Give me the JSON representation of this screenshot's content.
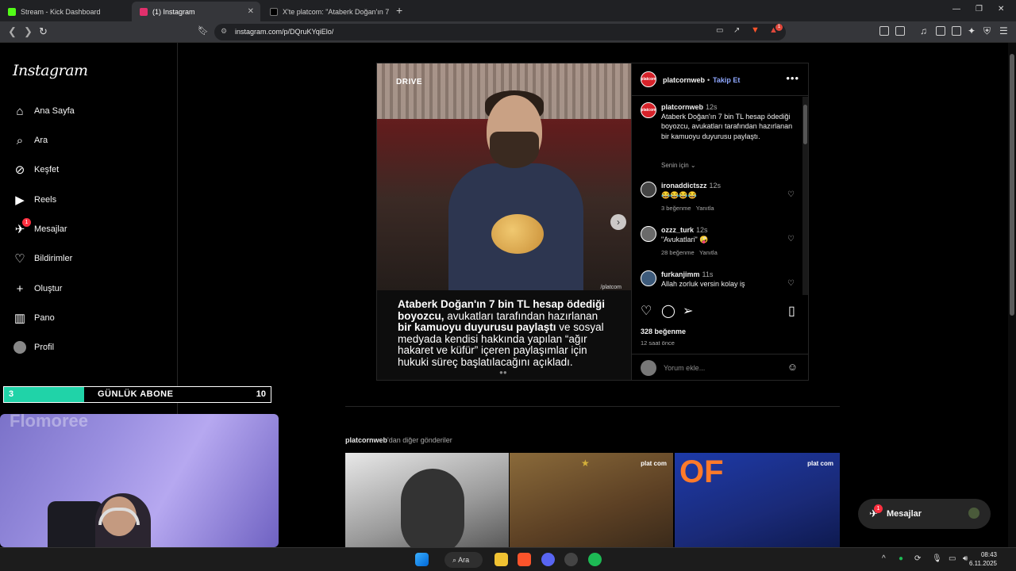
{
  "browser": {
    "tabs": [
      {
        "title": "Stream - Kick Dashboard",
        "color": "#53fc18"
      },
      {
        "title": "(1) Instagram",
        "color": "#e1306c"
      },
      {
        "title": "X'te platcom: \"Ataberk Doğan'ın 7 bin",
        "color": "#000000"
      }
    ],
    "url": "instagram.com/p/DQruKYqiElo/",
    "notif_count": "1"
  },
  "sidebar": {
    "logo": "Instagram",
    "items": [
      {
        "label": "Ana Sayfa",
        "icon": "home-icon"
      },
      {
        "label": "Ara",
        "icon": "search-icon"
      },
      {
        "label": "Keşfet",
        "icon": "compass-icon"
      },
      {
        "label": "Reels",
        "icon": "reels-icon"
      },
      {
        "label": "Mesajlar",
        "icon": "messenger-icon",
        "badge": "1"
      },
      {
        "label": "Bildirimler",
        "icon": "heart-icon"
      },
      {
        "label": "Oluştur",
        "icon": "plus-icon"
      },
      {
        "label": "Pano",
        "icon": "dashboard-icon"
      },
      {
        "label": "Profil",
        "icon": "avatar-icon"
      }
    ]
  },
  "overlay": {
    "sub_goal": {
      "current": "3",
      "label": "GÜNLÜK ABONE",
      "target": "10",
      "progress": 0.3,
      "fill_color": "#20d3a8"
    },
    "webcam_text": "Flomoree"
  },
  "post": {
    "media": {
      "brand": "DRIVE",
      "watermark": "/platcom",
      "caption_bold_1": "Ataberk Doğan'ın 7 bin TL hesap ödediği boyozcu,",
      "caption_plain_1": " avukatları tarafından hazırlanan ",
      "caption_bold_2": "bir kamuoyu duyurusu paylaştı",
      "caption_plain_2": " ve sosyal medyada kendisi hakkında yapılan “ağır hakaret ve küfür” içeren paylaşımlar için hukuki süreç başlatılacağını açıkladı."
    },
    "author": "platcornweb",
    "follow_label": "Takip Et",
    "separator": "•",
    "avatar_text": "platcom",
    "caption": {
      "user": "platcornweb",
      "time": "12s",
      "text": "Ataberk Doğan'ın 7 bin TL hesap ödediği boyozcu, avukatları tarafından hazırlanan bir kamuoyu duyurusu paylaştı."
    },
    "for_you": "Senin için",
    "comments": [
      {
        "user": "ironaddictszz",
        "time": "12s",
        "text": "😂😂😂😂",
        "likes": "3 beğenme",
        "reply": "Yanıtla"
      },
      {
        "user": "ozzz_turk",
        "time": "12s",
        "text": "\"Avukatlari\" 🤪",
        "likes": "28 beğenme",
        "reply": "Yanıtla"
      },
      {
        "user": "furkanjimm",
        "time": "11s",
        "text": "Allah zorluk versin kolay iş",
        "likes": "",
        "reply": ""
      }
    ],
    "likes": "328 beğenme",
    "ago": "12 saat önce",
    "comment_placeholder": "Yorum ekle..."
  },
  "more_posts": {
    "user": "platcornweb",
    "suffix": "'dan diğer gönderiler",
    "thumb_logo": "plat com",
    "thumb_text": "OF"
  },
  "messages_pill": {
    "label": "Mesajlar",
    "badge": "1"
  },
  "taskbar": {
    "search": "Ara",
    "time": "08:43",
    "date": "6.11.2025"
  }
}
